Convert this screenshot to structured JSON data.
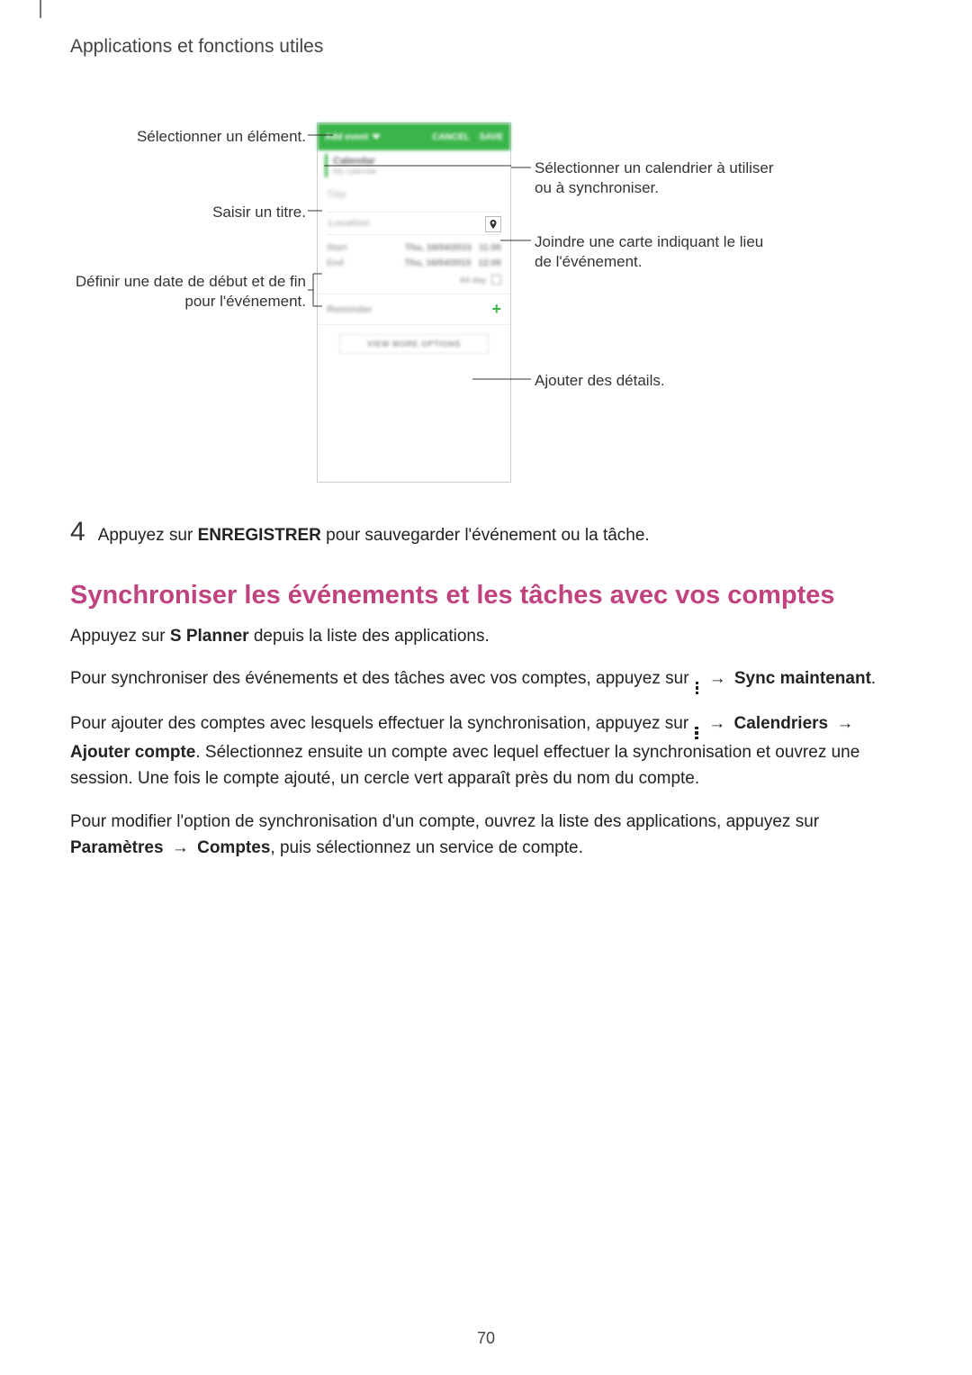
{
  "header": "Applications et fonctions utiles",
  "figure": {
    "phone": {
      "toolbar_dropdown": "Add event",
      "toolbar_cancel": "CANCEL",
      "toolbar_save": "SAVE",
      "calendar_line1": "Calendar",
      "calendar_line2": "My calendar",
      "title_placeholder": "Title",
      "location_placeholder": "Location",
      "start_label": "Start",
      "start_date": "Thu, 16/04/2015",
      "start_time": "11:00",
      "end_label": "End",
      "end_date": "Thu, 16/04/2015",
      "end_time": "12:00",
      "allday_label": "All day",
      "reminder_label": "Reminder",
      "more_label": "VIEW MORE OPTIONS"
    },
    "callouts": {
      "c1": "Sélectionner un élément.",
      "c2": "Saisir un titre.",
      "c3_a": "Définir une date de début et de fin",
      "c3_b": "pour l'événement.",
      "c4_a": "Sélectionner un calendrier à utiliser",
      "c4_b": "ou à synchroniser.",
      "c5_a": "Joindre une carte indiquant le lieu",
      "c5_b": "de l'événement.",
      "c6": "Ajouter des détails."
    }
  },
  "step4": {
    "num": "4",
    "pre": "Appuyez sur ",
    "bold": "ENREGISTRER",
    "post": " pour sauvegarder l'événement ou la tâche."
  },
  "heading2": "Synchroniser les événements et les tâches avec vos comptes",
  "p1": {
    "a": "Appuyez sur ",
    "b": "S Planner",
    "c": " depuis la liste des applications."
  },
  "p2": {
    "a": "Pour synchroniser des événements et des tâches avec vos comptes, appuyez sur ",
    "arrow": "→",
    "b": "Sync maintenant",
    "dot": "."
  },
  "p3": {
    "a": "Pour ajouter des comptes avec lesquels effectuer la synchronisation, appuyez sur ",
    "arrow": "→",
    "b": "Calendriers",
    "arrow2": "→",
    "c": "Ajouter compte",
    "d": ". Sélectionnez ensuite un compte avec lequel effectuer la synchronisation et ouvrez une session. Une fois le compte ajouté, un cercle vert apparaît près du nom du compte."
  },
  "p4": {
    "a": "Pour modifier l'option de synchronisation d'un compte, ouvrez la liste des applications, appuyez sur ",
    "b": "Paramètres",
    "arrow": "→",
    "c": "Comptes",
    "d": ", puis sélectionnez un service de compte."
  },
  "page_number": "70"
}
